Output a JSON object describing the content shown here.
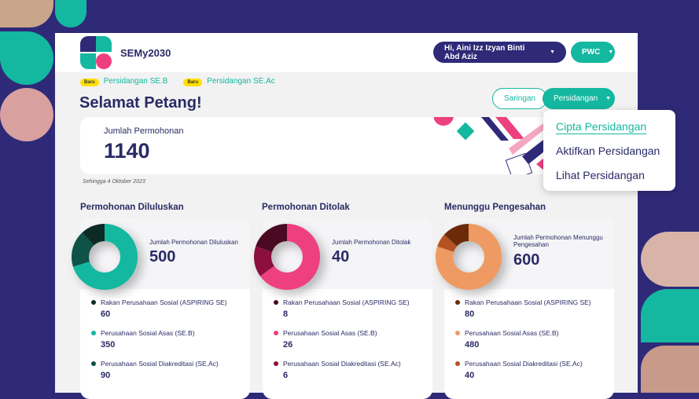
{
  "header": {
    "brand": "SEMy2030",
    "user": "Hi, Aini Izz Izyan Binti Abd Aziz",
    "org": "PWC"
  },
  "links": [
    {
      "badge": "Baru",
      "label": "Persidangan SE.B"
    },
    {
      "badge": "Baru",
      "label": "Persidangan SE.Ac"
    }
  ],
  "greeting": "Selamat Petang!",
  "buttons": {
    "filter": "Saringan",
    "conference": "Persidangan"
  },
  "menu": [
    "Cipta Persidangan",
    "Aktifkan Persidangan",
    "Lihat Persidangan"
  ],
  "total": {
    "label": "Jumlah Permohonan",
    "value": "1140",
    "date": "Sehingga 4 Oktober 2023"
  },
  "cards": [
    {
      "title": "Permohonan Diluluskan",
      "label": "Jumlah Permohonan Diluluskan",
      "total": "500",
      "items": [
        {
          "label": "Rakan Perusahaan Sosial (ASPIRING SE)",
          "value": "60",
          "color": "#0d2a24"
        },
        {
          "label": "Perusahaan Sosial Asas (SE.B)",
          "value": "350",
          "color": "#14b8a0"
        },
        {
          "label": "Perusahaan Sosial Diakreditasi (SE.Ac)",
          "value": "90",
          "color": "#0e5248"
        }
      ]
    },
    {
      "title": "Permohonan Ditolak",
      "label": "Jumlah Permohonan Ditolak",
      "total": "40",
      "items": [
        {
          "label": "Rakan Perusahaan Sosial (ASPIRING SE)",
          "value": "8",
          "color": "#4a0a22"
        },
        {
          "label": "Perusahaan Sosial Asas (SE.B)",
          "value": "26",
          "color": "#ee3f7e"
        },
        {
          "label": "Perusahaan Sosial Diakreditasi (SE.Ac)",
          "value": "6",
          "color": "#8c0f3c"
        }
      ]
    },
    {
      "title": "Menunggu Pengesahan",
      "label": "Jumlah Permohonan Menunggu Pengesahan",
      "total": "600",
      "items": [
        {
          "label": "Rakan Perusahaan Sosial (ASPIRING SE)",
          "value": "80",
          "color": "#6b2a0a"
        },
        {
          "label": "Perusahaan Sosial Asas (SE.B)",
          "value": "480",
          "color": "#ef9a62"
        },
        {
          "label": "Perusahaan Sosial Diakreditasi (SE.Ac)",
          "value": "40",
          "color": "#b5521f"
        }
      ]
    }
  ]
}
